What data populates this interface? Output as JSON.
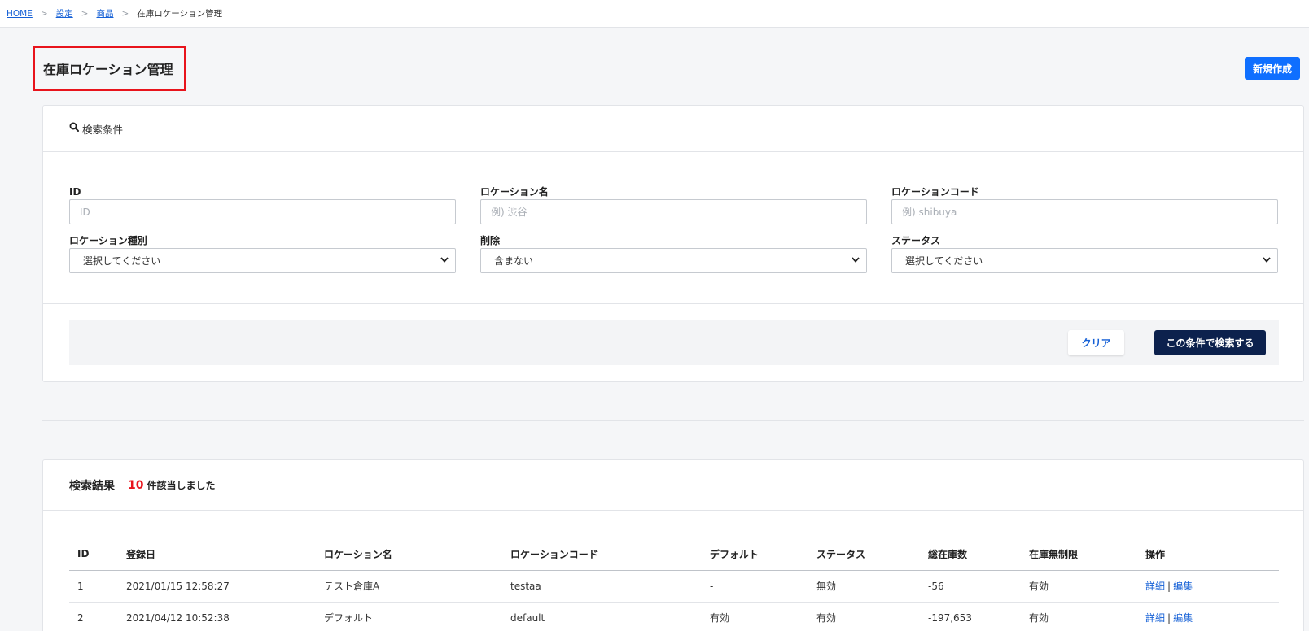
{
  "breadcrumb": {
    "home": "HOME",
    "settings": "設定",
    "products": "商品",
    "current": "在庫ロケーション管理",
    "separator": ">"
  },
  "page": {
    "title": "在庫ロケーション管理",
    "new_button": "新規作成"
  },
  "search": {
    "header": "検索条件",
    "fields": {
      "id": {
        "label": "ID",
        "placeholder": "ID"
      },
      "location_name": {
        "label": "ロケーション名",
        "placeholder": "例) 渋谷"
      },
      "location_code": {
        "label": "ロケーションコード",
        "placeholder": "例) shibuya"
      },
      "location_type": {
        "label": "ロケーション種別",
        "value": "選択してください"
      },
      "deleted": {
        "label": "削除",
        "value": "含まない"
      },
      "status": {
        "label": "ステータス",
        "value": "選択してください"
      }
    },
    "clear_button": "クリア",
    "search_button": "この条件で検索する"
  },
  "results": {
    "title": "検索結果",
    "count": "10",
    "count_suffix": "件該当しました",
    "columns": [
      "ID",
      "登録日",
      "ロケーション名",
      "ロケーションコード",
      "デフォルト",
      "ステータス",
      "総在庫数",
      "在庫無制限",
      "操作"
    ],
    "rows": [
      {
        "id": "1",
        "date": "2021/01/15 12:58:27",
        "name": "テスト倉庫A",
        "code": "testaa",
        "default": "-",
        "status": "無効",
        "total": "-56",
        "unlimited": "有効",
        "detail": "詳細",
        "sep": "|",
        "edit": "編集"
      },
      {
        "id": "2",
        "date": "2021/04/12 10:52:38",
        "name": "デフォルト",
        "code": "default",
        "default": "有効",
        "status": "有効",
        "total": "-197,653",
        "unlimited": "有効",
        "detail": "詳細",
        "sep": "|",
        "edit": "編集"
      }
    ]
  },
  "colors": {
    "primary": "#0f6fff",
    "navy": "#0c214d",
    "highlight": "#e8141c",
    "link": "#1560d6"
  },
  "icons": {
    "search": "search-icon",
    "dropdown": "chevron-down-icon"
  }
}
